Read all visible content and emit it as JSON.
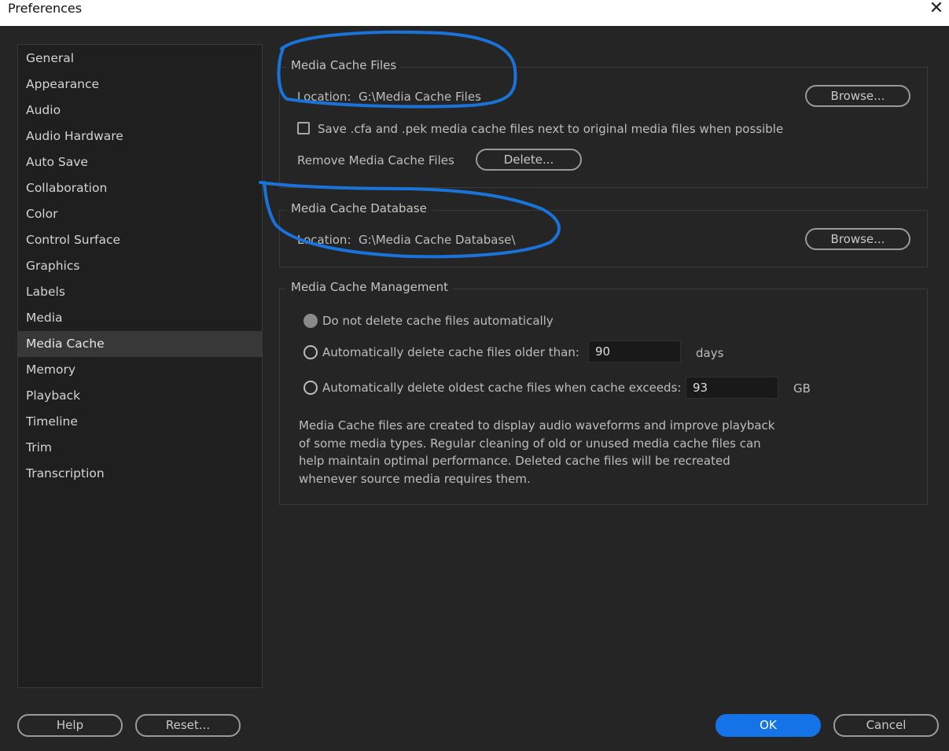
{
  "window": {
    "title": "Preferences",
    "close_icon": "close-icon"
  },
  "sidebar": {
    "items": [
      {
        "label": "General"
      },
      {
        "label": "Appearance"
      },
      {
        "label": "Audio"
      },
      {
        "label": "Audio Hardware"
      },
      {
        "label": "Auto Save"
      },
      {
        "label": "Collaboration"
      },
      {
        "label": "Color"
      },
      {
        "label": "Control Surface"
      },
      {
        "label": "Graphics"
      },
      {
        "label": "Labels"
      },
      {
        "label": "Media"
      },
      {
        "label": "Media Cache",
        "selected": true
      },
      {
        "label": "Memory"
      },
      {
        "label": "Playback"
      },
      {
        "label": "Timeline"
      },
      {
        "label": "Trim"
      },
      {
        "label": "Transcription"
      }
    ]
  },
  "media_cache_files": {
    "title": "Media Cache Files",
    "location_label": "Location:",
    "location_value": "G:\\Media Cache Files",
    "browse_label": "Browse...",
    "save_checkbox_label": "Save .cfa and .pek media cache files next to original media files when possible",
    "save_checkbox_checked": false,
    "remove_label": "Remove Media Cache Files",
    "delete_label": "Delete..."
  },
  "media_cache_database": {
    "title": "Media Cache Database",
    "location_label": "Location:",
    "location_value": "G:\\Media Cache Database\\",
    "browse_label": "Browse..."
  },
  "media_cache_management": {
    "title": "Media Cache Management",
    "option_no_delete": "Do not delete cache files automatically",
    "option_older_than": "Automatically delete cache files older than:",
    "older_than_value": "90",
    "older_than_unit": "days",
    "option_exceeds": "Automatically delete oldest cache files when cache exceeds:",
    "exceeds_value": "93",
    "exceeds_unit": "GB",
    "selected_option": "option_no_delete",
    "note": "Media Cache files are created to display audio waveforms and improve playback of some media types.  Regular cleaning of old or unused media cache files can help maintain optimal performance. Deleted cache files will be recreated whenever source media requires them."
  },
  "footer": {
    "help_label": "Help",
    "reset_label": "Reset...",
    "ok_label": "OK",
    "cancel_label": "Cancel"
  },
  "colors": {
    "annotation": "#1a73d9",
    "accent": "#1473e6"
  }
}
